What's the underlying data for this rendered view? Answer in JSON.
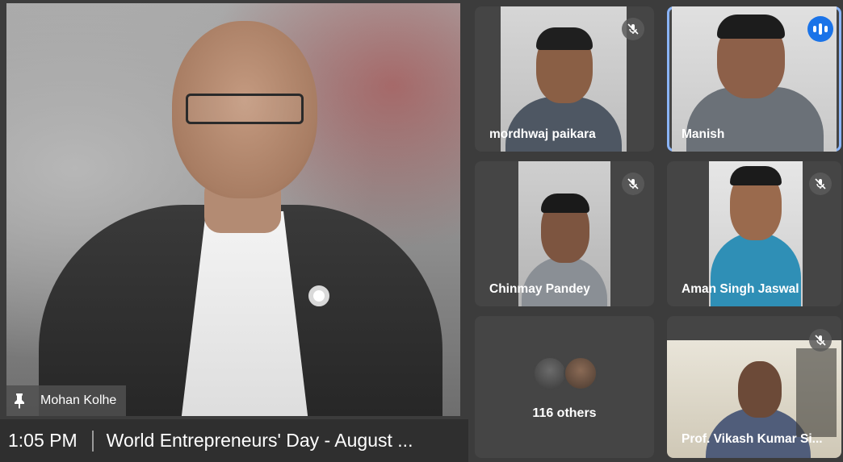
{
  "main_speaker": {
    "name": "Mohan Kolhe",
    "pin_icon": "pin-icon"
  },
  "bottom_bar": {
    "time": "1:05 PM",
    "meeting_title": "World Entrepreneurs' Day - August ..."
  },
  "participants": [
    {
      "name": "mordhwaj paikara",
      "mic": "muted"
    },
    {
      "name": "Manish",
      "mic": "speaking"
    },
    {
      "name": "Chinmay Pandey",
      "mic": "muted"
    },
    {
      "name": "Aman Singh Jaswal",
      "mic": "muted"
    },
    {
      "name": "Prof. Vikash Kumar Si...",
      "mic": "muted"
    }
  ],
  "others": {
    "label": "116 others"
  },
  "colors": {
    "speaking_accent": "#1a73e8",
    "active_outline": "#8ab4f8",
    "tile_bg": "#454545"
  }
}
